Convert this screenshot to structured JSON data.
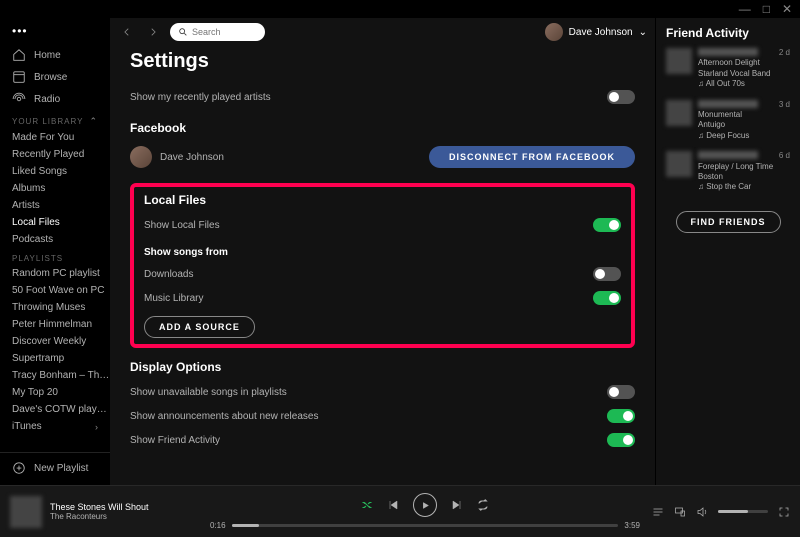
{
  "titlebar": {
    "min": "—",
    "max": "□",
    "close": "✕"
  },
  "sidebar": {
    "nav": [
      {
        "icon": "home",
        "label": "Home"
      },
      {
        "icon": "browse",
        "label": "Browse"
      },
      {
        "icon": "radio",
        "label": "Radio"
      }
    ],
    "library_label": "YOUR LIBRARY",
    "library": [
      "Made For You",
      "Recently Played",
      "Liked Songs",
      "Albums",
      "Artists",
      "Local Files",
      "Podcasts"
    ],
    "playlists_label": "PLAYLISTS",
    "playlists": [
      "Random PC playlist",
      "50 Foot Wave on PC",
      "Throwing Muses",
      "Peter Himmelman",
      "Discover Weekly",
      "Supertramp",
      "Tracy Bonham – Th…",
      "My Top 20",
      "Dave's COTW play…",
      "iTunes"
    ],
    "new_playlist": "New Playlist"
  },
  "topbar": {
    "search_placeholder": "Search",
    "user": "Dave Johnson"
  },
  "settings": {
    "title": "Settings",
    "recently_played": "Show my recently played artists",
    "facebook": {
      "heading": "Facebook",
      "name": "Dave Johnson",
      "disconnect": "DISCONNECT FROM FACEBOOK"
    },
    "local": {
      "heading": "Local Files",
      "show": "Show Local Files",
      "songs_from": "Show songs from",
      "downloads": "Downloads",
      "music_library": "Music Library",
      "add_source": "ADD A SOURCE"
    },
    "display": {
      "heading": "Display Options",
      "unavailable": "Show unavailable songs in playlists",
      "announcements": "Show announcements about new releases",
      "friend_activity": "Show Friend Activity"
    }
  },
  "right": {
    "title": "Friend Activity",
    "friends": [
      {
        "track": "Afternoon Delight",
        "artist": "Starland Vocal Band",
        "context": "All Out 70s",
        "time": "2 d"
      },
      {
        "track": "Monumental",
        "artist": "Antuigo",
        "context": "Deep Focus",
        "time": "3 d"
      },
      {
        "track": "Foreplay / Long Time",
        "artist": "Boston",
        "context": "Stop the Car",
        "time": "6 d"
      }
    ],
    "find": "FIND FRIENDS"
  },
  "player": {
    "track": "These Stones Will Shout",
    "artist": "The Raconteurs",
    "elapsed": "0:16",
    "total": "3:59"
  }
}
